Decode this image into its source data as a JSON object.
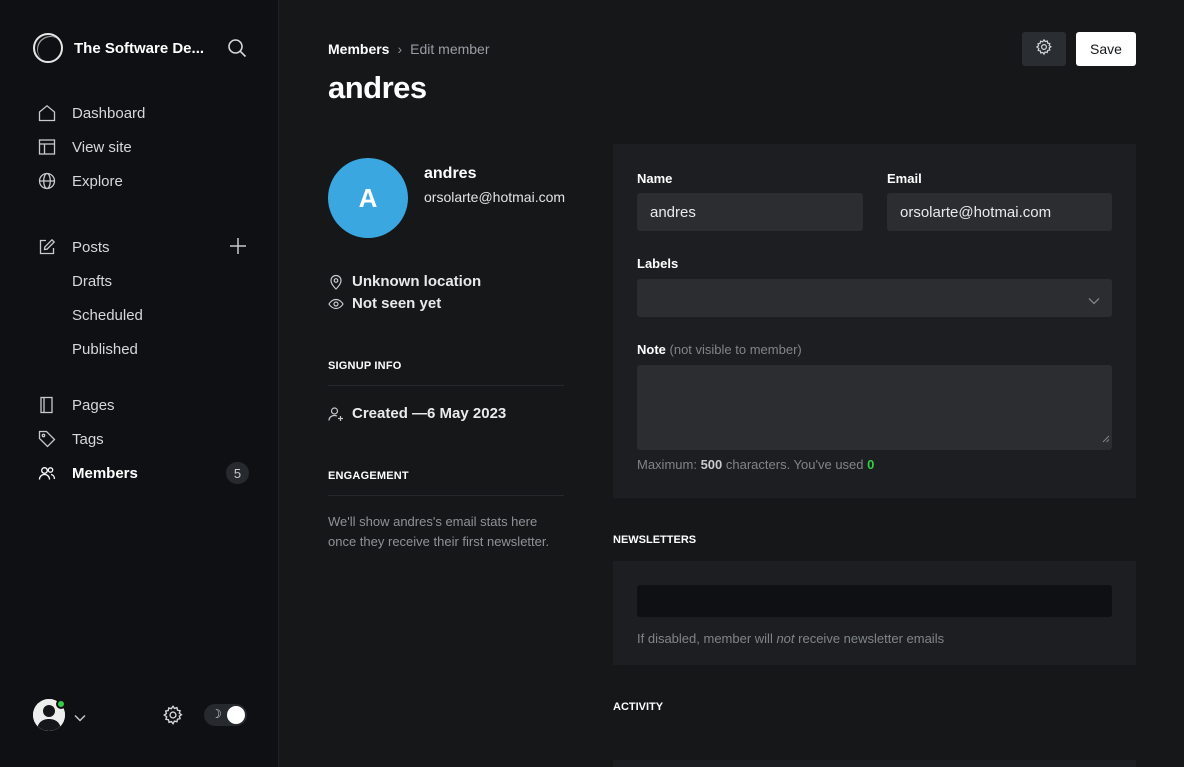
{
  "sidebar": {
    "brand_title": "The Software De...",
    "nav": [
      {
        "label": "Dashboard",
        "icon": "home-icon"
      },
      {
        "label": "View site",
        "icon": "layout-icon"
      },
      {
        "label": "Explore",
        "icon": "globe-icon"
      }
    ],
    "posts": {
      "label": "Posts",
      "icon": "edit-icon"
    },
    "post_subitems": [
      "Drafts",
      "Scheduled",
      "Published"
    ],
    "lower_nav": [
      {
        "label": "Pages",
        "icon": "pages-icon"
      },
      {
        "label": "Tags",
        "icon": "tag-icon"
      },
      {
        "label": "Members",
        "icon": "members-icon"
      }
    ],
    "members_count": "5",
    "theme_toggle_glyph": "☽"
  },
  "header": {
    "breadcrumb_parent": "Members",
    "breadcrumb_separator": "›",
    "breadcrumb_current": "Edit member",
    "title": "andres",
    "save_label": "Save"
  },
  "member": {
    "avatar_initial": "A",
    "name": "andres",
    "email": "orsolarte@hotmai.com",
    "location": "Unknown location",
    "seen": "Not seen yet",
    "signup_heading": "SIGNUP INFO",
    "created_prefix": "Created — ",
    "created_date": "6 May 2023",
    "engagement_heading": "ENGAGEMENT",
    "engagement_text": "We'll show andres's email stats here once they receive their first newsletter."
  },
  "form": {
    "name_label": "Name",
    "name_value": "andres",
    "email_label": "Email",
    "email_value": "orsolarte@hotmai.com",
    "labels_label": "Labels",
    "note_label": "Note",
    "note_hint": "(not visible to member)",
    "note_count_prefix": "Maximum: ",
    "note_count_max": "500",
    "note_count_middle": " characters. You've used ",
    "note_count_used": "0"
  },
  "newsletters": {
    "heading": "NEWSLETTERS",
    "help_prefix": "If disabled, member will ",
    "help_em": "not",
    "help_suffix": " receive newsletter emails"
  },
  "activity": {
    "heading": "ACTIVITY"
  },
  "colors": {
    "accent_green": "#30cf43",
    "avatar_blue": "#3aa7e1"
  }
}
